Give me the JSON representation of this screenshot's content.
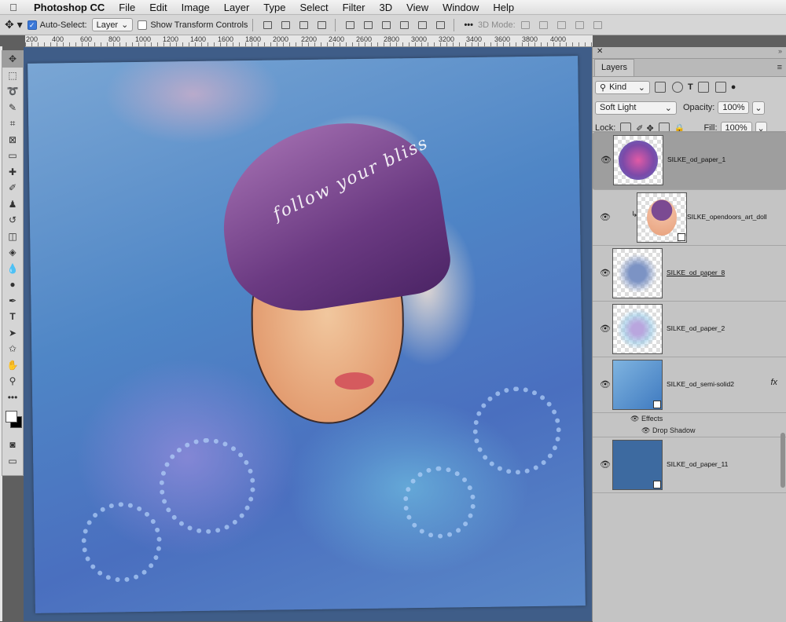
{
  "menubar": {
    "apple": "",
    "items": [
      "Photoshop CC",
      "File",
      "Edit",
      "Image",
      "Layer",
      "Type",
      "Select",
      "Filter",
      "3D",
      "View",
      "Window",
      "Help"
    ]
  },
  "options_bar": {
    "auto_select_label": "Auto-Select:",
    "auto_select_checked": true,
    "auto_select_target": "Layer",
    "transform_label": "Show Transform Controls",
    "transform_checked": false,
    "more": "•••",
    "mode_3d_label": "3D Mode:"
  },
  "ruler": {
    "ticks": [
      "200",
      "400",
      "600",
      "800",
      "1000",
      "1200",
      "1400",
      "1600",
      "1800",
      "2000",
      "2200",
      "2400",
      "2600",
      "2800",
      "3000",
      "3200",
      "3400",
      "3600",
      "3800",
      "4000"
    ]
  },
  "artwork": {
    "script_text": "follow your bliss"
  },
  "layers_panel": {
    "close": "✕",
    "grip": "»",
    "tab_label": "Layers",
    "filter_kind": "Kind",
    "blend_mode": "Soft Light",
    "opacity_label": "Opacity:",
    "opacity_value": "100%",
    "lock_label": "Lock:",
    "fill_label": "Fill:",
    "fill_value": "100%",
    "layers": [
      {
        "name": "SILKE_od_paper_1",
        "selected": true
      },
      {
        "name": "SILKE_opendoors_art_doll",
        "clipped": true
      },
      {
        "name": "SILKE_od_paper_8"
      },
      {
        "name": "SILKE_od_paper_2"
      },
      {
        "name": "SILKE_od_semi-solid2",
        "fx": "fx"
      },
      {
        "name": "SILKE_od_paper_11"
      }
    ],
    "effects_label": "Effects",
    "drop_shadow_label": "Drop Shadow"
  }
}
